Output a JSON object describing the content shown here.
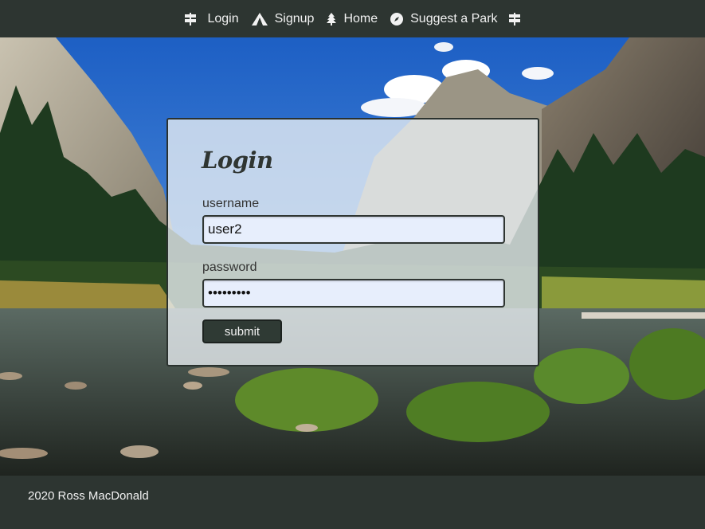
{
  "nav": {
    "items": [
      {
        "label": "Login",
        "icon": "signpost-icon"
      },
      {
        "label": "Signup",
        "icon": "tent-icon"
      },
      {
        "label": "Home",
        "icon": "tree-icon"
      },
      {
        "label": "Suggest a Park",
        "icon": "compass-icon"
      }
    ],
    "end_icon": "signpost-icon"
  },
  "login": {
    "title": "Login",
    "username_label": "username",
    "username_value": "user2",
    "password_label": "password",
    "password_value": "•••••••••",
    "submit_label": "submit"
  },
  "footer": {
    "text": "2020 Ross MacDonald"
  },
  "colors": {
    "nav_bg": "#2d3531",
    "card_bg": "#ebf0f3",
    "input_bg": "#e7eefc",
    "button_bg": "#2f3a34"
  }
}
